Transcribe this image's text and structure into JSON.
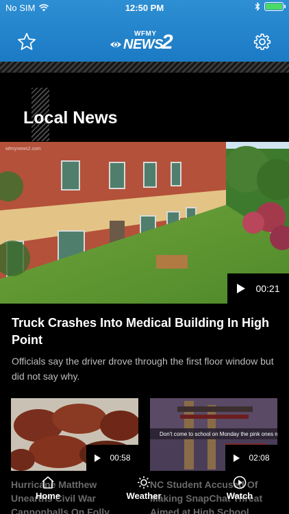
{
  "status_bar": {
    "carrier": "No SIM",
    "time": "12:50 PM",
    "battery_level": 1.0
  },
  "header": {
    "logo_small": "WFMY",
    "logo_main": "NEWS",
    "logo_number": "2",
    "favorites_icon": "star-icon",
    "settings_icon": "gear-icon"
  },
  "section": {
    "title": "Local News"
  },
  "hero": {
    "image_watermark": "wfmynews2.com",
    "duration": "00:21",
    "title": "Truck Crashes Into Medical Building In High Point",
    "summary": "Officials say the driver drove through the first floor window but did not say why."
  },
  "cards": [
    {
      "duration": "00:58",
      "title": "Hurricane Matthew Unearths Civil War Cannonballs On Folly Beach"
    },
    {
      "duration": "02:08",
      "caption": "Don't come to school on Monday the pink ones mine",
      "title": "NC Student Accused Of Making SnapChat Threat Aimed at High School"
    }
  ],
  "tabbar": {
    "home": "Home",
    "weather": "Weather",
    "watch": "Watch"
  },
  "colors": {
    "header_blue": "#1b7ac4",
    "battery_green": "#4cd964"
  }
}
